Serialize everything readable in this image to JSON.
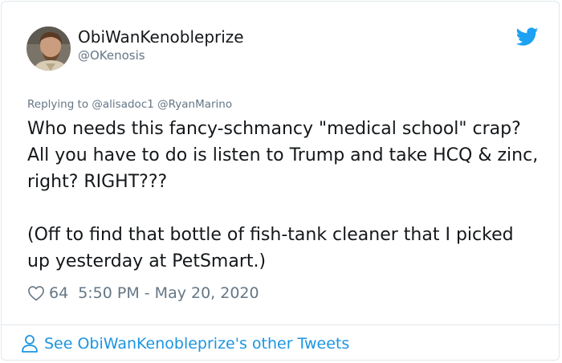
{
  "user": {
    "display_name": "ObiWanKenobleprize",
    "handle": "@OKenosis"
  },
  "reply": {
    "prefix": "Replying to",
    "mentions": [
      "@alisadoc1",
      "@RyanMarino"
    ]
  },
  "tweet": {
    "paragraphs": [
      "Who needs this fancy-schmancy \"medical school\" crap? All you have to do is listen to Trump and take HCQ & zinc, right? RIGHT???",
      "(Off to find that bottle of fish-tank cleaner that I picked up yesterday at PetSmart.)"
    ]
  },
  "meta": {
    "likes": "64",
    "timestamp": "5:50 PM - May 20, 2020"
  },
  "footer": {
    "link_label": "See ObiWanKenobleprize's other Tweets"
  },
  "icons": {
    "twitter_bird": "twitter-bird-icon",
    "like": "heart-icon",
    "profile": "person-icon"
  },
  "colors": {
    "twitter_blue": "#1da1f2",
    "link_blue": "#1b95e0",
    "secondary_text": "#657786",
    "primary_text": "#14171a",
    "border": "#e1e8ed"
  }
}
